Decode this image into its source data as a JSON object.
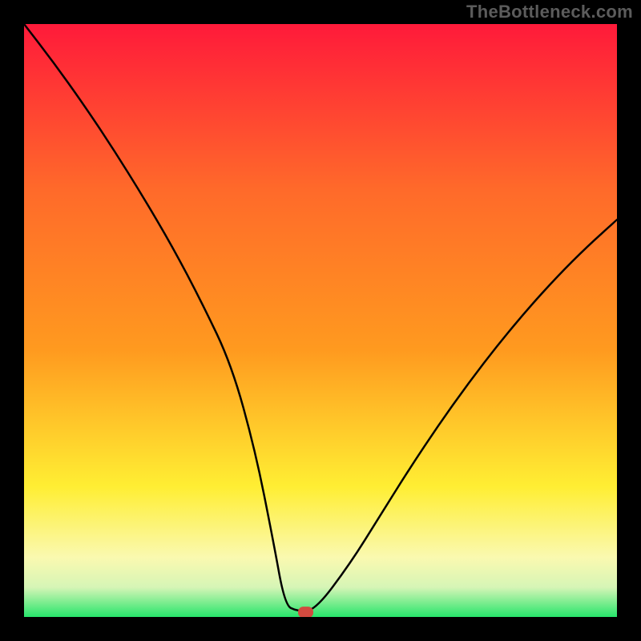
{
  "watermark": "TheBottleneck.com",
  "colors": {
    "background_black": "#000000",
    "red": "#ff1a3a",
    "orange": "#ff9a1f",
    "yellow": "#ffee33",
    "pale_yellow": "#faf9b0",
    "faint_green": "#d6f5b6",
    "green": "#27e56b",
    "curve_stroke": "#000000",
    "marker_fill": "#d24a3f"
  },
  "chart_data": {
    "type": "line",
    "title": "",
    "xlabel": "",
    "ylabel": "",
    "xlim": [
      0,
      100
    ],
    "ylim": [
      0,
      100
    ],
    "legend": false,
    "grid": false,
    "annotations": [],
    "series": [
      {
        "name": "bottleneck-curve",
        "x": [
          0,
          5,
          10,
          15,
          20,
          25,
          30,
          35,
          39,
          42,
          44,
          46,
          49,
          55,
          60,
          65,
          70,
          75,
          80,
          85,
          90,
          95,
          100
        ],
        "y": [
          100,
          93.5,
          86.5,
          79,
          71,
          62.5,
          53,
          42.5,
          28,
          13,
          2,
          1,
          1,
          9,
          17,
          25,
          32.5,
          39.5,
          46,
          52,
          57.5,
          62.5,
          67
        ]
      }
    ],
    "marker": {
      "x": 47.5,
      "y": 0.8,
      "shape": "pill"
    }
  }
}
